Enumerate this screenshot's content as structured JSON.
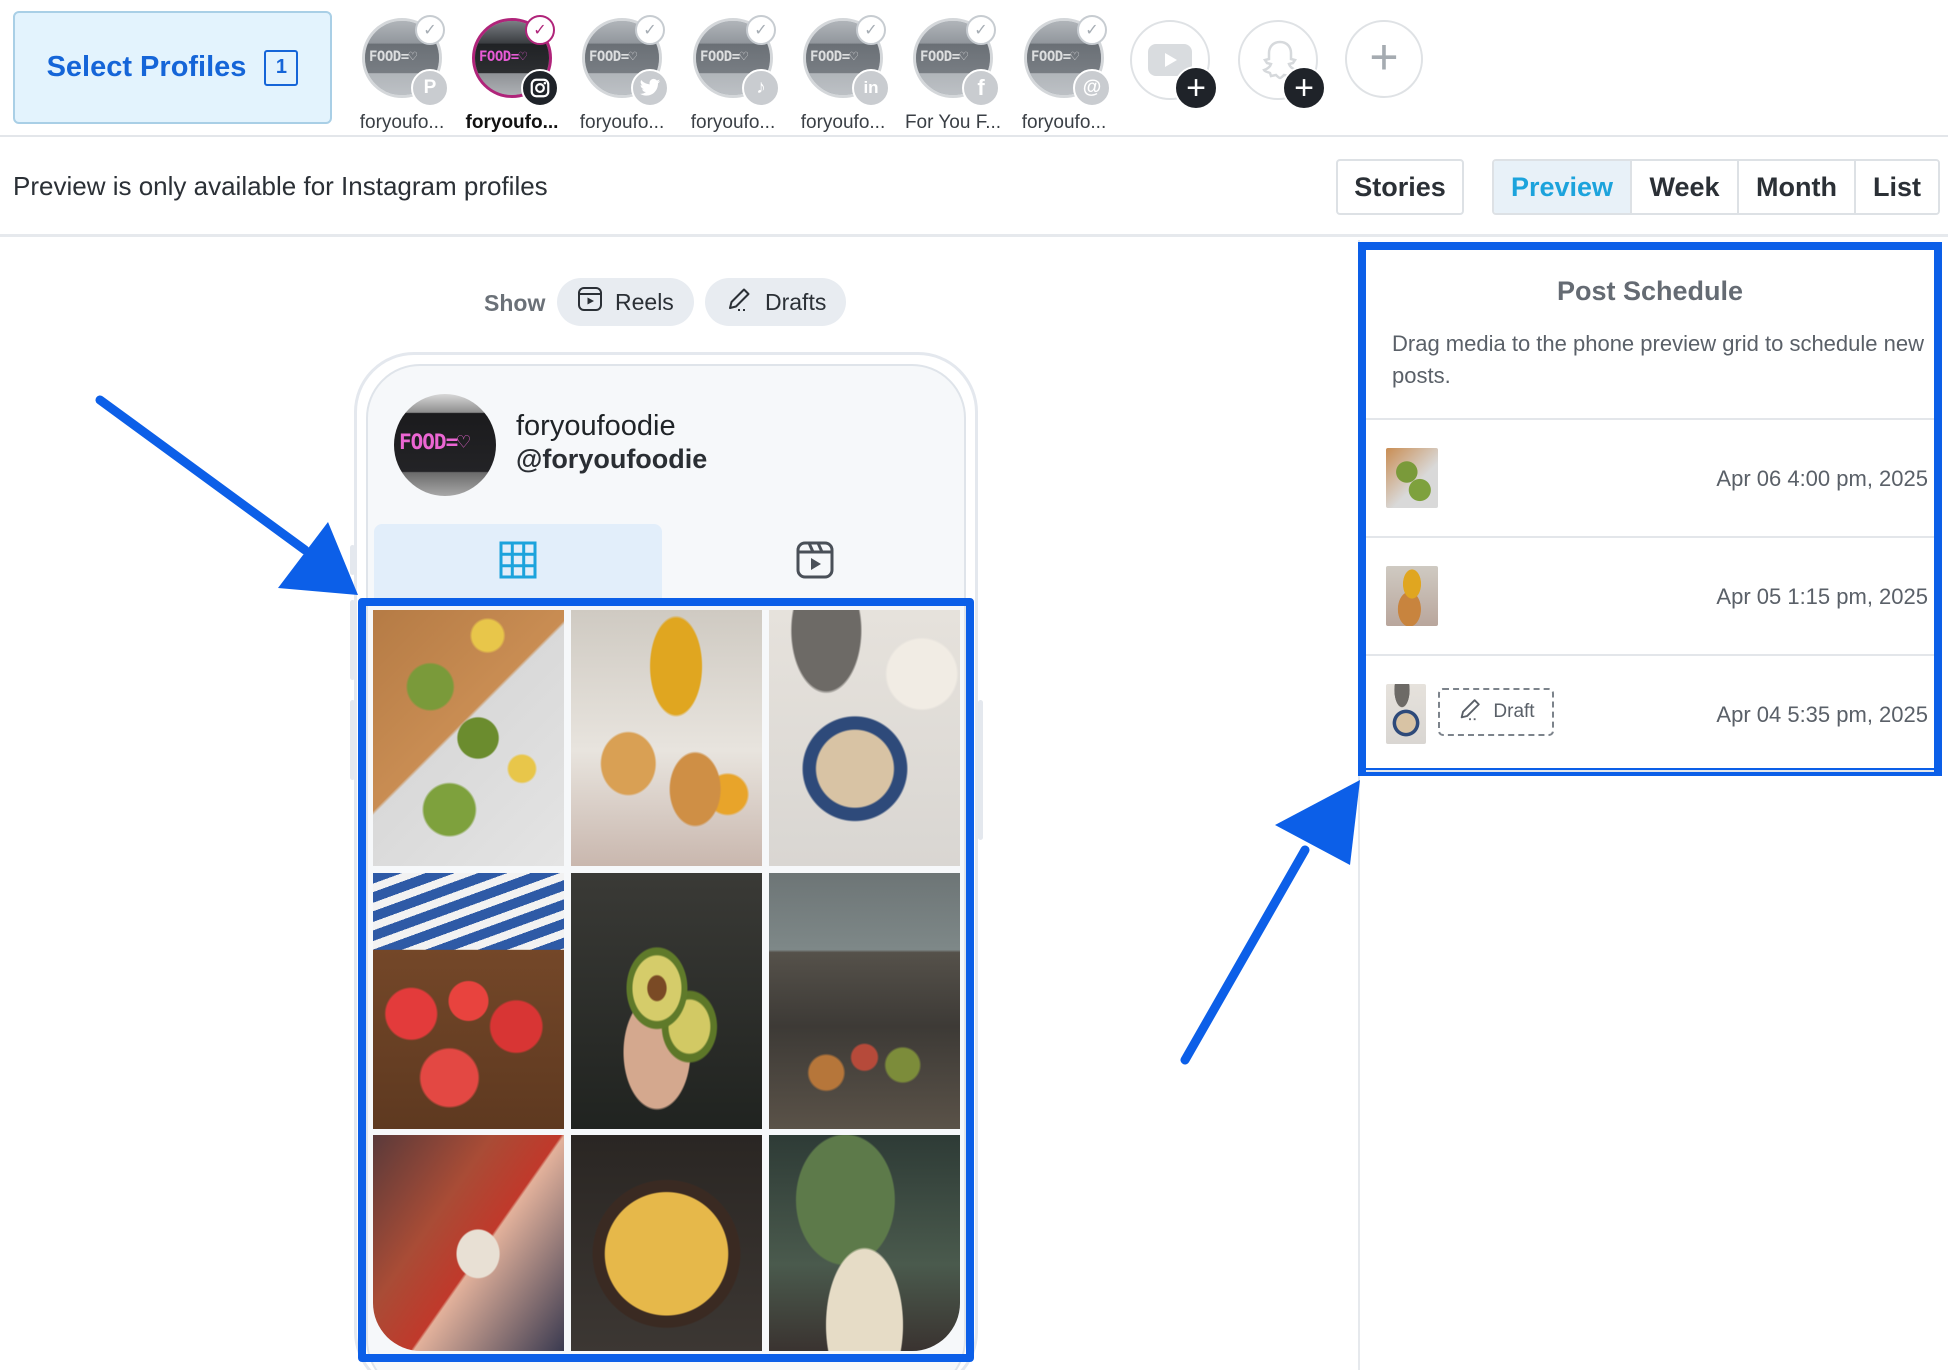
{
  "topbar": {
    "select_profiles_label": "Select Profiles",
    "select_profiles_count": "1",
    "profiles": [
      {
        "name": "foryoufo...",
        "network": "pinterest",
        "network_glyph": "P",
        "network_color": "#c9ccd0",
        "selected": false
      },
      {
        "name": "foryoufo...",
        "network": "instagram",
        "network_glyph": "◎",
        "network_color": "#1f2329",
        "selected": true
      },
      {
        "name": "foryoufo...",
        "network": "twitter",
        "network_glyph": "t",
        "network_color": "#c9ccd0",
        "selected": false
      },
      {
        "name": "foryoufo...",
        "network": "tiktok",
        "network_glyph": "♪",
        "network_color": "#c9ccd0",
        "selected": false
      },
      {
        "name": "foryoufo...",
        "network": "linkedin",
        "network_glyph": "in",
        "network_color": "#c9ccd0",
        "selected": false
      },
      {
        "name": "For You F...",
        "network": "facebook",
        "network_glyph": "f",
        "network_color": "#c9ccd0",
        "selected": false
      },
      {
        "name": "foryoufo...",
        "network": "threads",
        "network_glyph": "@",
        "network_color": "#c9ccd0",
        "selected": false
      }
    ],
    "avatar_text": "FOOD=♡",
    "add_networks": [
      "youtube",
      "snapchat"
    ],
    "add_profile_icon": "plus-icon"
  },
  "subbar": {
    "notice": "Preview is only available for Instagram profiles",
    "stories_label": "Stories",
    "view_tabs": [
      {
        "label": "Preview",
        "active": true
      },
      {
        "label": "Week",
        "active": false
      },
      {
        "label": "Month",
        "active": false
      },
      {
        "label": "List",
        "active": false
      }
    ]
  },
  "filter": {
    "show_label": "Show",
    "reels_label": "Reels",
    "drafts_label": "Drafts"
  },
  "phone": {
    "avatar_text": "FOOD=♡",
    "display_name": "foryoufoodie",
    "handle": "@foryoufoodie",
    "tabs": [
      "grid-icon",
      "reels-icon"
    ],
    "grid": [
      "avocado-toast",
      "bruschetta-bowl",
      "oatmeal-blueberries",
      "watermelon-slices",
      "avocado-half",
      "food-pins-on-wood",
      "hot-sauce-bottle",
      "skillet-frittata",
      "plant-and-cocktail"
    ]
  },
  "schedule": {
    "title": "Post Schedule",
    "description": "Drag media to the phone preview grid to schedule new posts.",
    "items": [
      {
        "time": "Apr 06 4:00 pm, 2025",
        "draft": false
      },
      {
        "time": "Apr 05 1:15 pm, 2025",
        "draft": false
      },
      {
        "time": "Apr 04 5:35 pm, 2025",
        "draft": true,
        "draft_label": "Draft"
      }
    ]
  },
  "colors": {
    "accent_blue": "#1565d8",
    "highlight_blue": "#0c5fe8",
    "instagram_ring": "#b0247a",
    "active_tab_text": "#1ca3dc"
  }
}
